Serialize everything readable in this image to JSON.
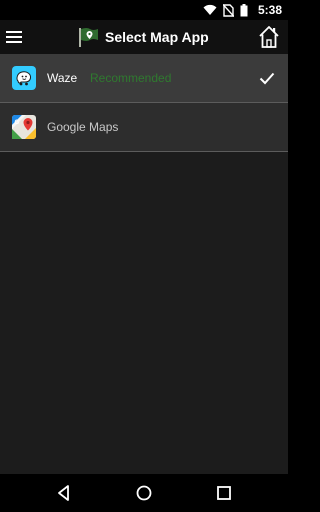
{
  "status_bar": {
    "time": "5:38",
    "icons": [
      "wifi-icon",
      "no-sim-icon",
      "battery-icon"
    ]
  },
  "toolbar": {
    "title": "Select Map App",
    "icons": [
      "menu-icon",
      "app-flag-icon",
      "home-icon"
    ]
  },
  "map_apps": [
    {
      "label": "Waze",
      "badge": "Recommended",
      "selected": true,
      "icon": "waze-icon"
    },
    {
      "label": "Google Maps",
      "badge": "",
      "selected": false,
      "icon": "google-maps-icon"
    }
  ],
  "nav_bar": {
    "icons": [
      "back-icon",
      "home-nav-icon",
      "recents-icon"
    ]
  },
  "colors": {
    "selected_row": "#3b3b3b",
    "row": "#2d2d2d",
    "recommended_text": "#2f7a2f",
    "background": "#1c1c1c"
  }
}
